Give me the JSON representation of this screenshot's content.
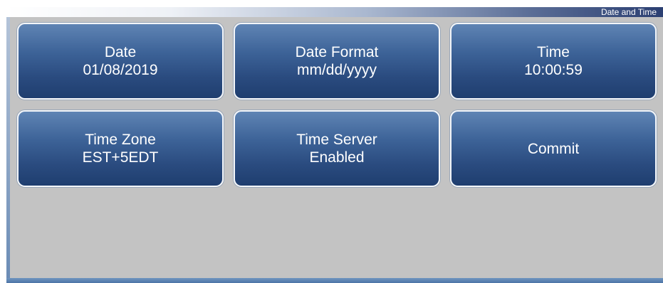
{
  "header": {
    "title": "Date and Time"
  },
  "buttons": {
    "date": {
      "label": "Date",
      "value": "01/08/2019"
    },
    "date_format": {
      "label": "Date Format",
      "value": "mm/dd/yyyy"
    },
    "time": {
      "label": "Time",
      "value": "10:00:59"
    },
    "time_zone": {
      "label": "Time Zone",
      "value": "EST+5EDT"
    },
    "time_server": {
      "label": "Time Server",
      "value": "Enabled"
    },
    "commit": {
      "label": "Commit"
    }
  }
}
